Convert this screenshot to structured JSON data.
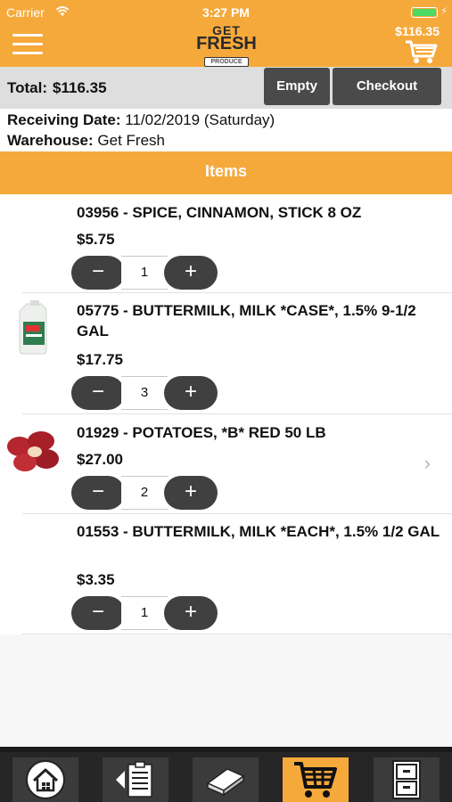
{
  "status": {
    "carrier": "Carrier",
    "time": "3:27 PM"
  },
  "header": {
    "menu_icon": "hamburger-icon",
    "logo": {
      "line1": "GET",
      "line2": "FRESH",
      "line3": "PRODUCE"
    },
    "cart_total": "$116.35",
    "cart_icon": "shopping-cart-icon"
  },
  "summary": {
    "total_label": "Total:",
    "total_value": "$116.35",
    "empty_label": "Empty",
    "checkout_label": "Checkout"
  },
  "info": {
    "receiving_label": "Receiving Date:",
    "receiving_value": "11/02/2019 (Saturday)",
    "warehouse_label": "Warehouse:",
    "warehouse_value": "Get Fresh"
  },
  "items_header": "Items",
  "items": [
    {
      "title": "03956 - SPICE, CINNAMON, STICK 8 OZ",
      "price": "$5.75",
      "qty": "1",
      "image": "none"
    },
    {
      "title": "05775 - BUTTERMILK, MILK *CASE*, 1.5% 9-1/2 GAL",
      "price": "$17.75",
      "qty": "3",
      "image": "milk-jug-image"
    },
    {
      "title": "01929 - POTATOES, *B* RED 50 LB",
      "price": "$27.00",
      "qty": "2",
      "image": "red-potatoes-image"
    },
    {
      "title": "01553 - BUTTERMILK, MILK *EACH*, 1.5% 1/2 GAL",
      "price": "$3.35",
      "qty": "1",
      "image": "none"
    }
  ],
  "stepper": {
    "minus": "−",
    "plus": "+"
  },
  "chevron": "›",
  "tabs": [
    {
      "icon": "home-icon",
      "active": false
    },
    {
      "icon": "order-list-icon",
      "active": false
    },
    {
      "icon": "catalog-book-icon",
      "active": false
    },
    {
      "icon": "shopping-cart-icon",
      "active": true
    },
    {
      "icon": "cabinet-icon",
      "active": false
    }
  ],
  "colors": {
    "accent": "#f6a93b",
    "dark": "#404040",
    "tabbar": "#262626"
  }
}
